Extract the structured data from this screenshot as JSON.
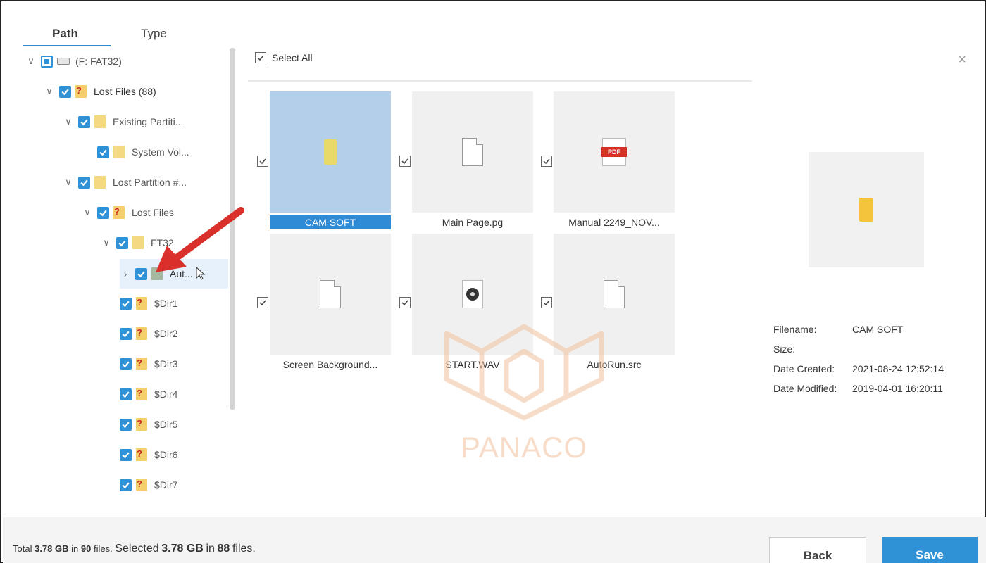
{
  "left": {
    "tabs": [
      {
        "label": "Path"
      },
      {
        "label": "Type"
      }
    ],
    "tree": [
      {
        "label": "(F: FAT32)"
      },
      {
        "label": "Lost Files (88)"
      },
      {
        "label": "Existing Partiti..."
      },
      {
        "label": "System Vol..."
      },
      {
        "label": "Lost Partition #..."
      },
      {
        "label": "Lost Files"
      },
      {
        "label": "FT32"
      },
      {
        "label": "Aut..."
      },
      {
        "label": "$Dir1"
      },
      {
        "label": "$Dir2"
      },
      {
        "label": "$Dir3"
      },
      {
        "label": "$Dir4"
      },
      {
        "label": "$Dir5"
      },
      {
        "label": "$Dir6"
      },
      {
        "label": "$Dir7"
      }
    ]
  },
  "middle": {
    "select_all_label": "Select All",
    "files": [
      {
        "name": "CAM SOFT",
        "icon": "folder-icon"
      },
      {
        "name": "Main Page.pg",
        "icon": "document-icon"
      },
      {
        "name": "Manual 2249_NOV...",
        "icon": "pdf-icon"
      },
      {
        "name": "Screen Background...",
        "icon": "document-icon"
      },
      {
        "name": "START.WAV",
        "icon": "audio-icon"
      },
      {
        "name": "AutoRun.src",
        "icon": "document-icon"
      }
    ]
  },
  "preview": {
    "close_label": "×",
    "info": [
      {
        "key": "Filename:",
        "value": "CAM SOFT"
      },
      {
        "key": "Size:",
        "value": ""
      },
      {
        "key": "Date Created:",
        "value": "2021-08-24 12:52:14"
      },
      {
        "key": "Date Modified:",
        "value": "2019-04-01 16:20:11"
      }
    ]
  },
  "watermark": {
    "text": "PANACO"
  },
  "footer": {
    "total_prefix": "Total",
    "total_size": "3.78 GB",
    "total_in": "in",
    "total_count": "90",
    "total_suffix": "files.",
    "selected_prefix": "Selected",
    "selected_size": "3.78 GB",
    "selected_in": "in",
    "selected_count": "88",
    "selected_suffix": "files.",
    "back_label": "Back",
    "save_label": "Save"
  },
  "colors": {
    "accent": "#2f92d6",
    "selected_tile": "#b3cfea",
    "arrow": "#d9302c",
    "watermark": "#f2c39e"
  }
}
